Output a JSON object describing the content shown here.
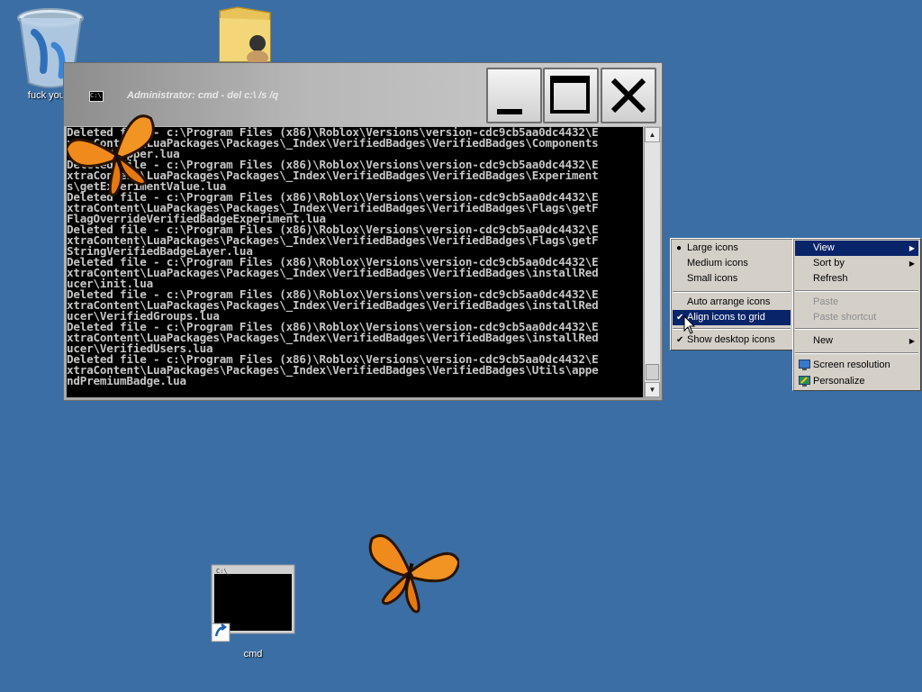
{
  "desktop": {
    "icons": [
      {
        "id": "recycle-bin",
        "label": "fuck you p",
        "icon": "recycle-bin-icon"
      },
      {
        "id": "user-folder",
        "label": "",
        "icon": "user-folder-icon"
      },
      {
        "id": "cmd-shortcut",
        "label": "cmd",
        "icon": "cmd-shortcut-icon"
      }
    ],
    "decorations": [
      "butterfly-icon",
      "butterfly-icon"
    ]
  },
  "cmd_window": {
    "title": "Administrator: cmd - del c:\\ /s /q",
    "app_icon_text": "C:\\",
    "buttons": {
      "minimize": "minimize-icon",
      "maximize": "maximize-icon",
      "close": "close-icon"
    },
    "lines": [
      "Deleted file - c:\\Program Files (x86)\\Roblox\\Versions\\version-cdc9cb5aa0dc4432\\E",
      "xtraContent\\LuaPackages\\Packages\\_Index\\VerifiedBadges\\VerifiedBadges\\Components",
      "\\EmojiWrapper.lua",
      "Deleted file - c:\\Program Files (x86)\\Roblox\\Versions\\version-cdc9cb5aa0dc4432\\E",
      "xtraContent\\LuaPackages\\Packages\\_Index\\VerifiedBadges\\VerifiedBadges\\Experiment",
      "s\\getExperimentValue.lua",
      "Deleted file - c:\\Program Files (x86)\\Roblox\\Versions\\version-cdc9cb5aa0dc4432\\E",
      "xtraContent\\LuaPackages\\Packages\\_Index\\VerifiedBadges\\VerifiedBadges\\Flags\\getF",
      "FlagOverrideVerifiedBadgeExperiment.lua",
      "Deleted file - c:\\Program Files (x86)\\Roblox\\Versions\\version-cdc9cb5aa0dc4432\\E",
      "xtraContent\\LuaPackages\\Packages\\_Index\\VerifiedBadges\\VerifiedBadges\\Flags\\getF",
      "StringVerifiedBadgeLayer.lua",
      "Deleted file - c:\\Program Files (x86)\\Roblox\\Versions\\version-cdc9cb5aa0dc4432\\E",
      "xtraContent\\LuaPackages\\Packages\\_Index\\VerifiedBadges\\VerifiedBadges\\installRed",
      "ucer\\init.lua",
      "Deleted file - c:\\Program Files (x86)\\Roblox\\Versions\\version-cdc9cb5aa0dc4432\\E",
      "xtraContent\\LuaPackages\\Packages\\_Index\\VerifiedBadges\\VerifiedBadges\\installRed",
      "ucer\\VerifiedGroups.lua",
      "Deleted file - c:\\Program Files (x86)\\Roblox\\Versions\\version-cdc9cb5aa0dc4432\\E",
      "xtraContent\\LuaPackages\\Packages\\_Index\\VerifiedBadges\\VerifiedBadges\\installRed",
      "ucer\\VerifiedUsers.lua",
      "Deleted file - c:\\Program Files (x86)\\Roblox\\Versions\\version-cdc9cb5aa0dc4432\\E",
      "xtraContent\\LuaPackages\\Packages\\_Index\\VerifiedBadges\\VerifiedBadges\\Utils\\appe",
      "ndPremiumBadge.lua"
    ],
    "scroll_position": 0.95
  },
  "context_menu": {
    "items": [
      {
        "label": "View",
        "selected": true,
        "submenu": true
      },
      {
        "label": "Sort by",
        "submenu": true
      },
      {
        "label": "Refresh"
      },
      {
        "label": "Paste",
        "disabled": true
      },
      {
        "label": "Paste shortcut",
        "disabled": true
      },
      {
        "label": "New",
        "submenu": true
      },
      {
        "label": "Screen resolution",
        "icon": "display-icon"
      },
      {
        "label": "Personalize",
        "icon": "personalize-icon"
      }
    ]
  },
  "view_submenu": {
    "items": [
      {
        "label": "Large icons",
        "bullet": true
      },
      {
        "label": "Medium icons"
      },
      {
        "label": "Small icons"
      },
      {
        "label": "Auto arrange icons"
      },
      {
        "label": "Align icons to grid",
        "checked": true,
        "selected": true
      },
      {
        "label": "Show desktop icons",
        "checked": true
      }
    ]
  },
  "colors": {
    "desktop_bg": "#3a6ea5",
    "menu_bg": "#d4d0c8",
    "menu_highlight": "#0a246a",
    "console_bg": "#000000",
    "console_text": "#c7c7c7"
  }
}
